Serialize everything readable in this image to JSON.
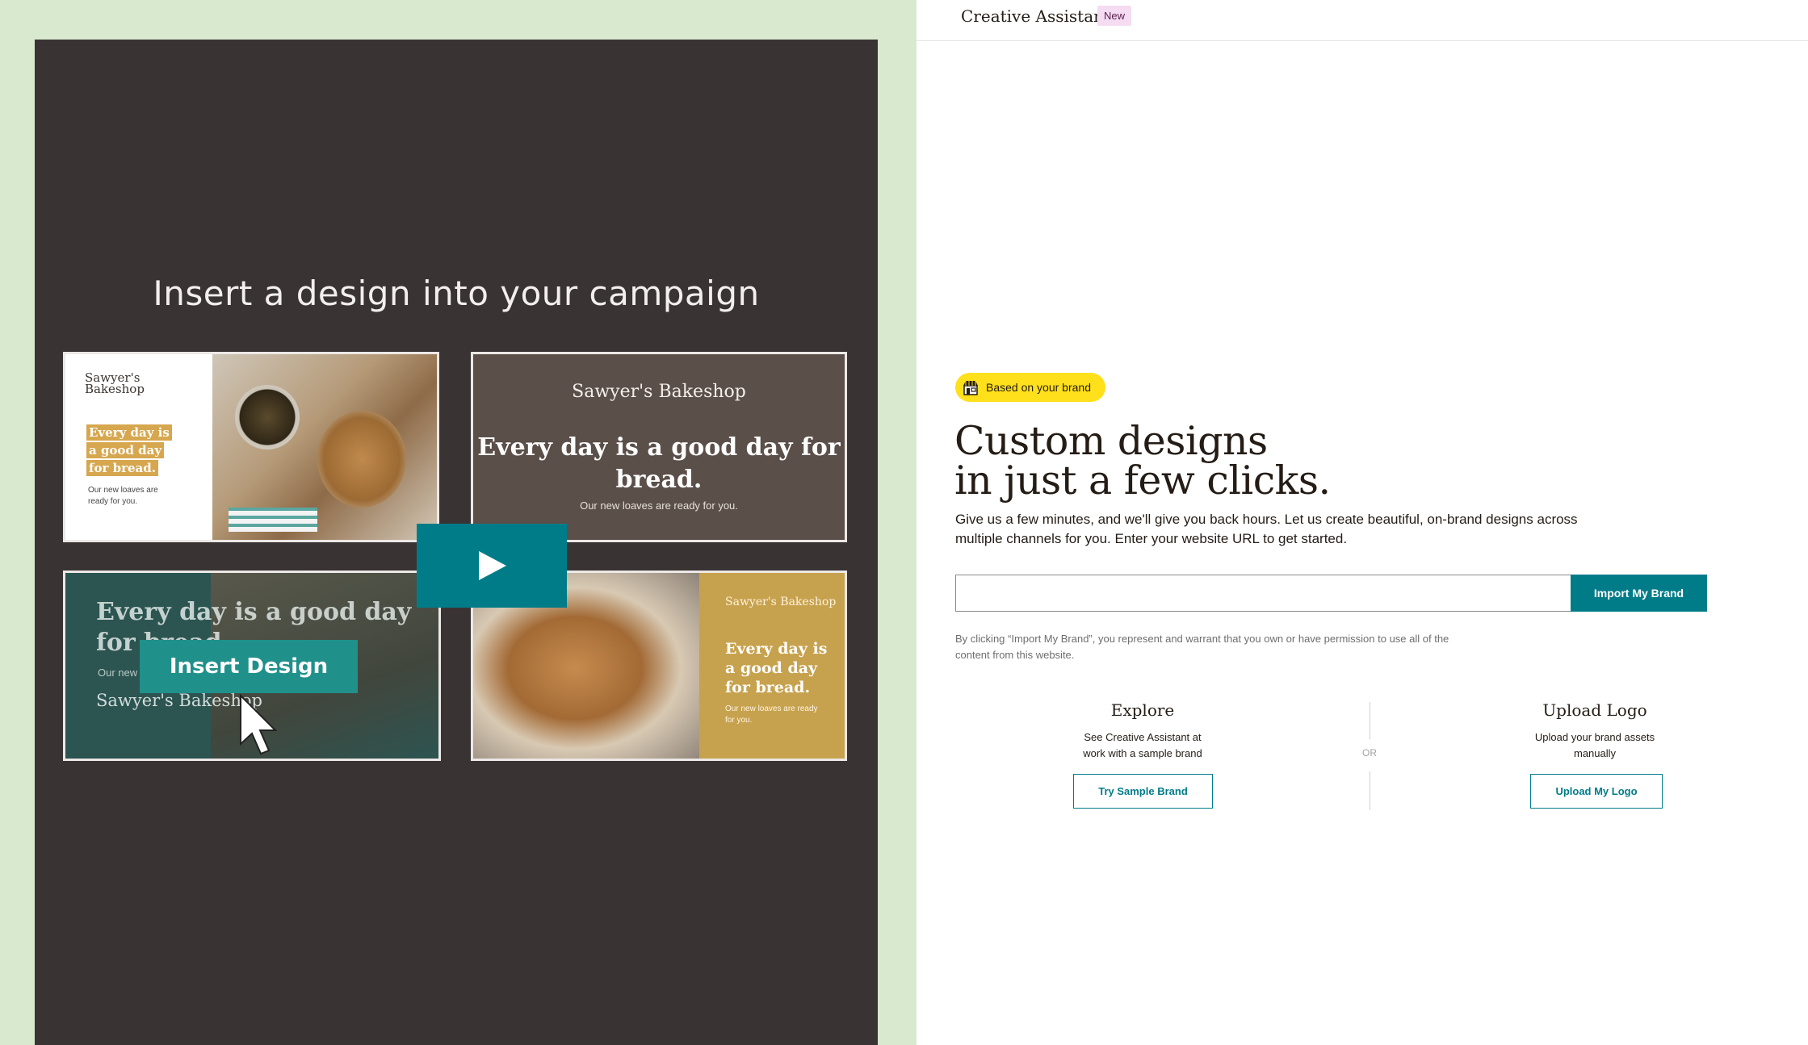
{
  "video": {
    "title": "Insert a design into your campaign",
    "card1": {
      "brand": "Sawyer's Bakeshop",
      "headline": "Every day is a good day for bread.",
      "sub": "Our new loaves are ready for you."
    },
    "card2": {
      "brand": "Sawyer's Bakeshop",
      "headline": "Every day is a good day for bread.",
      "sub": "Our new loaves are ready for you."
    },
    "card3": {
      "headline": "Every day is a good day for bread.",
      "sub": "Our new",
      "brand": "Sawyer's Bakeshop",
      "button": "Insert Design"
    },
    "card4": {
      "brand": "Sawyer's Bakeshop",
      "headline": "Every day is a good day for bread.",
      "sub": "Our new loaves are ready for you."
    },
    "play_icon": "play-icon"
  },
  "header": {
    "title": "Creative Assistant",
    "badge": "New"
  },
  "main": {
    "pill": "Based on your brand",
    "pill_icon": "storefront-icon",
    "headline_line1": "Custom designs",
    "headline_line2": "in just a few clicks.",
    "description": "Give us a few minutes, and we'll give you back hours. Let us create beautiful, on-brand designs across multiple channels for you. Enter your website URL to get started.",
    "url_input": {
      "value": "",
      "placeholder": ""
    },
    "import_button": "Import My Brand",
    "disclaimer": "By clicking “Import My Brand”, you represent and warrant that you own or have permission to use all of the content from this website.",
    "explore": {
      "title": "Explore",
      "description": "See Creative Assistant at work with a sample brand",
      "button": "Try Sample Brand"
    },
    "separator": "OR",
    "upload": {
      "title": "Upload Logo",
      "description": "Upload your brand assets manually",
      "button": "Upload My Logo"
    }
  },
  "colors": {
    "accent": "#007c89",
    "pill": "#ffe01b",
    "badge_bg": "#f5dcf2",
    "left_bg": "#d8e9cf",
    "video_bg": "#393334"
  }
}
